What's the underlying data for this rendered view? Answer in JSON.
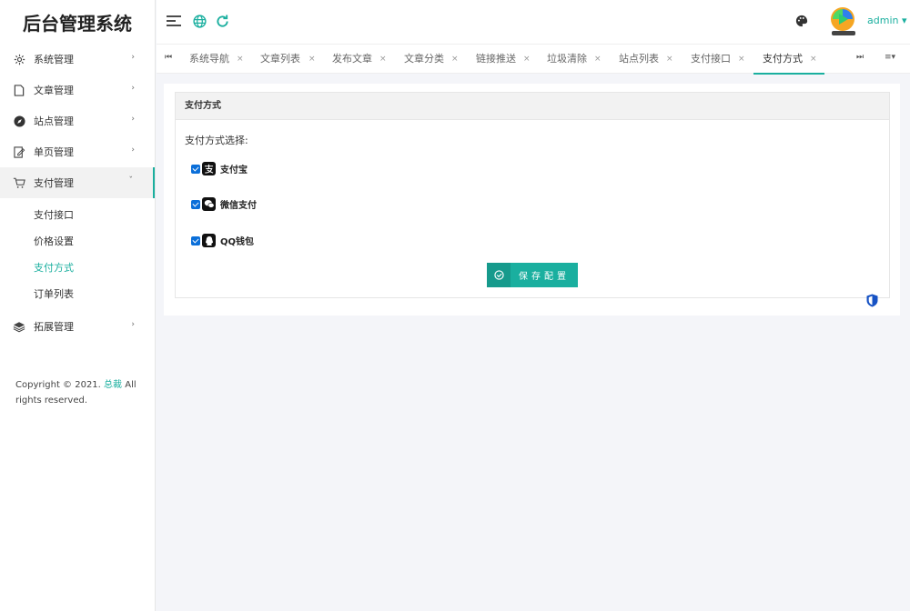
{
  "app": {
    "title": "后台管理系统"
  },
  "sidebar": {
    "items": [
      {
        "label": "系统管理",
        "icon": "gear-icon"
      },
      {
        "label": "文章管理",
        "icon": "file-icon"
      },
      {
        "label": "站点管理",
        "icon": "compass-icon"
      },
      {
        "label": "单页管理",
        "icon": "page-edit-icon"
      },
      {
        "label": "支付管理",
        "icon": "cart-icon"
      },
      {
        "label": "拓展管理",
        "icon": "layers-icon"
      }
    ],
    "submenu": [
      "支付接口",
      "价格设置",
      "支付方式",
      "订单列表"
    ],
    "active_sub": "支付方式"
  },
  "footer": {
    "prefix": "Copyright © 2021.",
    "brand": "总裁",
    "suffix": "All rights reserved."
  },
  "topbar": {
    "user": "admin ▾"
  },
  "tabs": [
    "系统导航",
    "文章列表",
    "发布文章",
    "文章分类",
    "链接推送",
    "垃圾清除",
    "站点列表",
    "支付接口",
    "支付方式"
  ],
  "tab_close": "×",
  "panel": {
    "title": "支付方式",
    "label": "支付方式选择:",
    "options": [
      {
        "label": "支付宝",
        "checked": true,
        "icon": "alipay-icon"
      },
      {
        "label": "微信支付",
        "checked": true,
        "icon": "wechat-icon"
      },
      {
        "label": "QQ钱包",
        "checked": true,
        "icon": "qq-icon"
      }
    ],
    "save_label": "保存配置"
  },
  "colors": {
    "accent": "#1aaf9f",
    "checkbox": "#0b6fd9"
  }
}
